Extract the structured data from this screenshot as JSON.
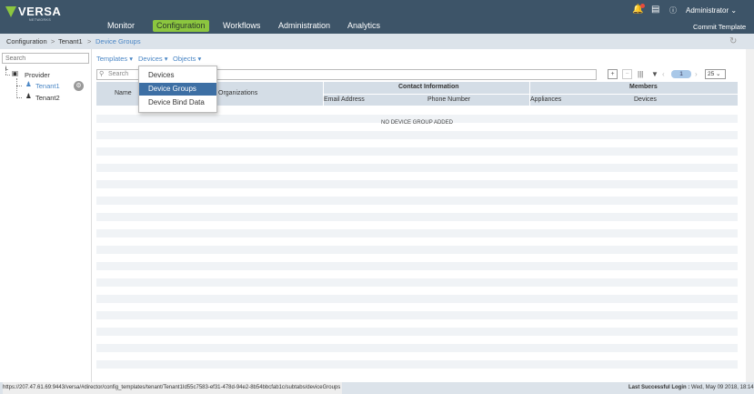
{
  "brand": {
    "name": "VERSA",
    "sub": "NETWORKS"
  },
  "nav": [
    "Monitor",
    "Configuration",
    "Workflows",
    "Administration",
    "Analytics"
  ],
  "header": {
    "user": "Administrator",
    "commit": "Commit Template"
  },
  "breadcrumb": [
    "Configuration",
    "Tenant1",
    "Device Groups"
  ],
  "left": {
    "search_placeholder": "Search",
    "root": "Provider",
    "tenants": [
      "Tenant1",
      "Tenant2"
    ]
  },
  "subtabs": [
    "Templates",
    "Devices",
    "Objects"
  ],
  "table_search_placeholder": "Search",
  "pager": {
    "page": "1",
    "page_size": "25"
  },
  "columns": {
    "name": "Name",
    "organizations": "Organizations",
    "contact_group": "Contact Information",
    "email": "Email Address",
    "phone": "Phone Number",
    "members_group": "Members",
    "appliances": "Appliances",
    "devices": "Devices"
  },
  "empty_message": "NO DEVICE GROUP ADDED",
  "dropdown": [
    "Devices",
    "Device Groups",
    "Device Bind Data"
  ],
  "status": {
    "url": "https://207.47.61.69:9443/versa/#director/config_templates/tenant/Tenant1Id55c7583-ef31-478d-94e2-8b54bbcfab1c/subtabs/deviceGroups",
    "last_login_label": "Last Successful Login :",
    "last_login_value": "Wed, May 09 2018, 18:14"
  },
  "colors": {
    "header": "#3d5468",
    "accent": "#8cc63f",
    "selection": "#3d6fa4",
    "link": "#4a86c5"
  }
}
